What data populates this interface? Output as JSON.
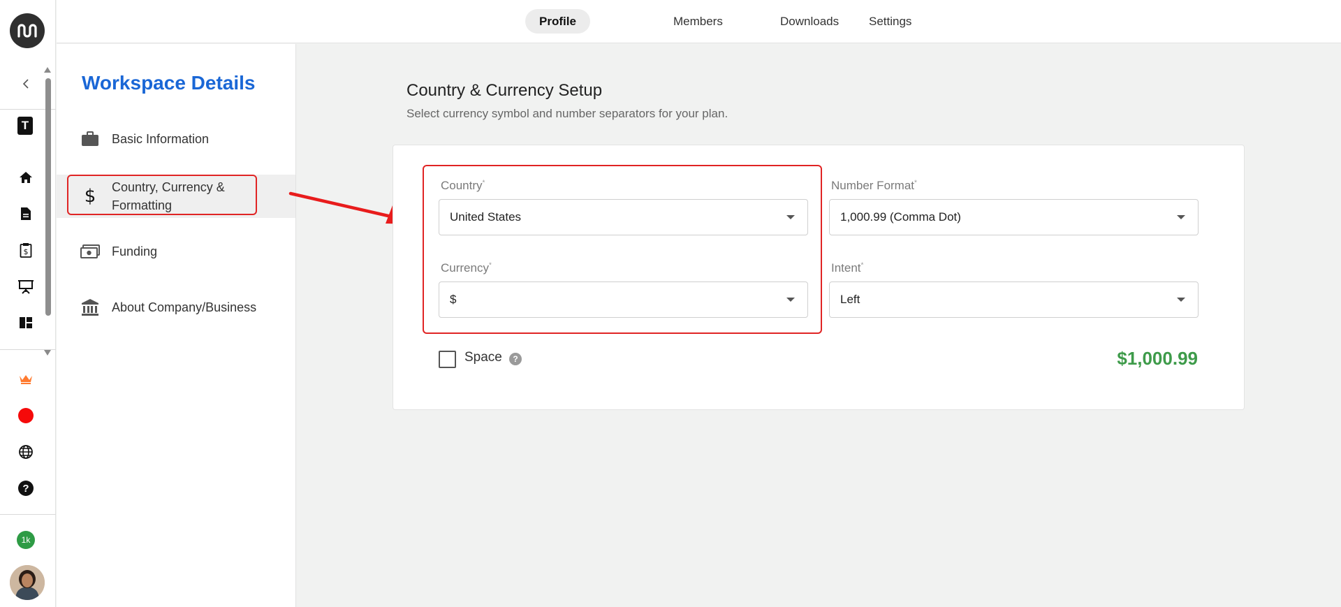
{
  "rail": {
    "workspace_badge": "T",
    "count_badge": "1k"
  },
  "tabs": [
    {
      "label": "Profile",
      "active": true
    },
    {
      "label": "Members",
      "active": false
    },
    {
      "label": "Downloads",
      "active": false
    },
    {
      "label": "Settings",
      "active": false
    }
  ],
  "panel": {
    "title": "Workspace Details",
    "items": [
      {
        "label": "Basic Information",
        "icon": "briefcase-icon"
      },
      {
        "label": "Country, Currency & Formatting",
        "icon": "dollar-icon",
        "selected": true
      },
      {
        "label": "Funding",
        "icon": "cash-icon"
      },
      {
        "label": "About Company/Business",
        "icon": "bank-icon"
      }
    ]
  },
  "main": {
    "title": "Country & Currency Setup",
    "subtitle": "Select currency symbol and number separators for your plan.",
    "fields": {
      "country": {
        "label": "Country",
        "required": "*",
        "value": "United States"
      },
      "currency": {
        "label": "Currency",
        "required": "*",
        "value": "$"
      },
      "number_format": {
        "label": "Number Format",
        "required": "*",
        "value": "1,000.99 (Comma Dot)"
      },
      "intent": {
        "label": "Intent",
        "required": "*",
        "value": "Left"
      }
    },
    "space_label": "Space",
    "space_checked": false,
    "preview": "$1,000.99"
  },
  "colors": {
    "accent_blue": "#1a67d6",
    "preview_green": "#3e9b4a",
    "highlight_red": "#e02424"
  }
}
